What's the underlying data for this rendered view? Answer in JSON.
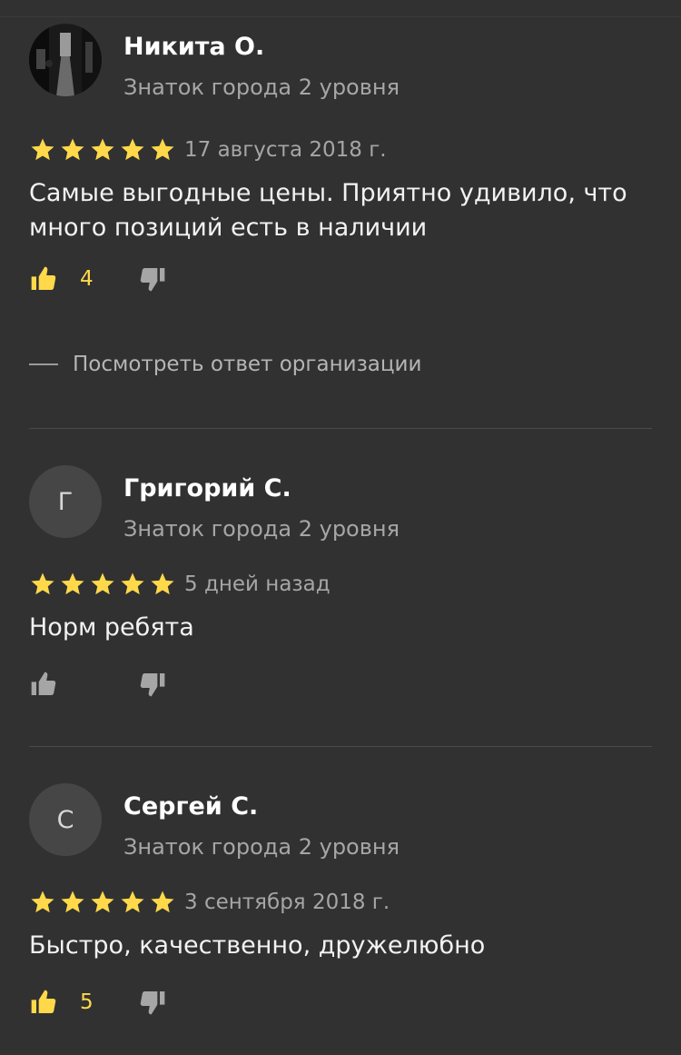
{
  "reviews": [
    {
      "author": "Никита О.",
      "level": "Знаток города 2 уровня",
      "avatar_letter": "",
      "avatar_type": "photo",
      "rating": 5,
      "date": "17 августа 2018 г.",
      "text": "Самые выгодные цены. Приятно удивило, что много позиций есть в наличии",
      "likes": "4",
      "reply_link": "Посмотреть ответ организации"
    },
    {
      "author": "Григорий С.",
      "level": "Знаток города 2 уровня",
      "avatar_letter": "Г",
      "avatar_type": "letter",
      "rating": 5,
      "date": "5 дней назад",
      "text": "Норм ребята",
      "likes": ""
    },
    {
      "author": "Сергей С.",
      "level": "Знаток города 2 уровня",
      "avatar_letter": "С",
      "avatar_type": "letter",
      "rating": 5,
      "date": "3 сентября 2018 г.",
      "text": "Быстро, качественно, дружелюбно",
      "likes": "5"
    }
  ],
  "colors": {
    "background": "#313131",
    "star": "#ffd94a",
    "like_active": "#ffd94a",
    "icon_inactive": "#a6a6a6",
    "secondary_text": "#a6a6a6"
  },
  "icons": {
    "star": "star-icon",
    "like": "thumbs-up-icon",
    "dislike": "thumbs-down-icon"
  }
}
